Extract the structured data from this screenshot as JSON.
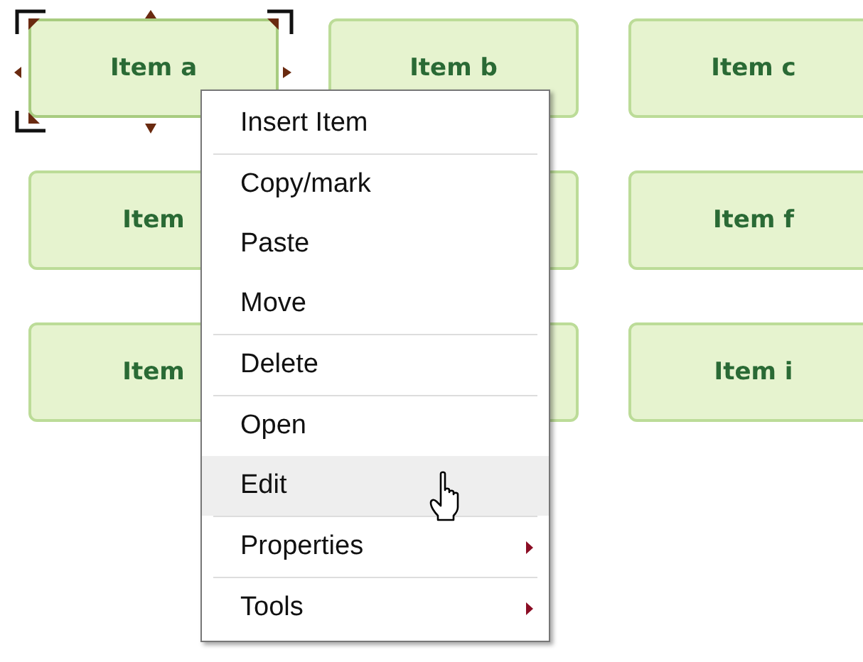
{
  "items": [
    {
      "label": "Item a",
      "selected": true
    },
    {
      "label": "Item b",
      "selected": false
    },
    {
      "label": "Item c",
      "selected": false
    },
    {
      "label": "Item",
      "selected": false
    },
    {
      "selected": false
    },
    {
      "label": "Item f",
      "selected": false
    },
    {
      "label": "Item",
      "selected": false
    },
    {
      "selected": false
    },
    {
      "label": "Item i",
      "selected": false
    }
  ],
  "context_menu": {
    "items": [
      {
        "label": "Insert Item",
        "hovered": false,
        "submenu": false,
        "separator_after": true
      },
      {
        "label": "Copy/mark",
        "hovered": false,
        "submenu": false,
        "separator_after": false
      },
      {
        "label": "Paste",
        "hovered": false,
        "submenu": false,
        "separator_after": false
      },
      {
        "label": "Move",
        "hovered": false,
        "submenu": false,
        "separator_after": true
      },
      {
        "label": "Delete",
        "hovered": false,
        "submenu": false,
        "separator_after": true
      },
      {
        "label": "Open",
        "hovered": false,
        "submenu": false,
        "separator_after": false
      },
      {
        "label": "Edit",
        "hovered": true,
        "submenu": false,
        "separator_after": true
      },
      {
        "label": "Properties",
        "hovered": false,
        "submenu": true,
        "separator_after": true
      },
      {
        "label": "Tools",
        "hovered": false,
        "submenu": true,
        "separator_after": false
      }
    ]
  }
}
